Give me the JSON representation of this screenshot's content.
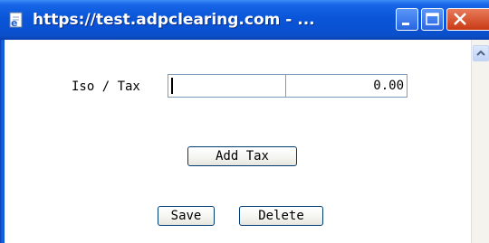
{
  "window": {
    "title": "https://test.adpclearing.com - ...",
    "title_icon": "ie-page-icon",
    "controls": [
      "minimize-icon",
      "maximize-icon",
      "close-icon"
    ]
  },
  "form": {
    "iso_tax_label": "Iso / Tax",
    "code_value": "",
    "rate_value": "0.00"
  },
  "buttons": {
    "add_tax": "Add Tax",
    "save": "Save",
    "delete": "Delete"
  },
  "colors": {
    "titlebar": "#0a55d8",
    "close_button": "#c83a14",
    "input_border": "#7f9db9",
    "button_border": "#003c74"
  }
}
